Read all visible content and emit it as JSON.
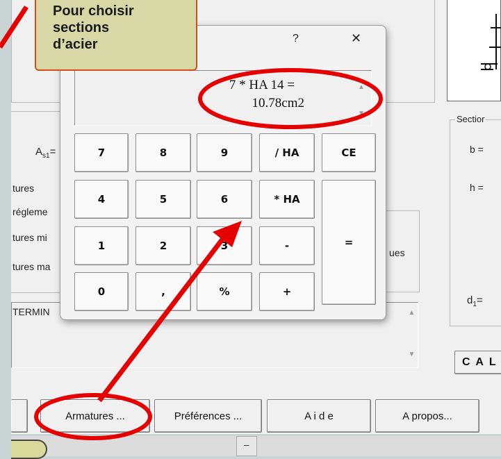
{
  "callout": {
    "lines": [
      "Pour  choisir",
      "sections",
      "d’acier"
    ]
  },
  "background": {
    "as1_label": "A",
    "as1_sub": "s1",
    "as1_eq": "=",
    "left_labels": [
      "tures",
      "régleme",
      "tures mi",
      "tures ma"
    ],
    "ues_label": "ues",
    "terminal_text": "TERMIN",
    "section_group_label": "Sectior",
    "right_labels": [
      "b =",
      "h ="
    ],
    "d1_label": "d",
    "d1_sub": "1",
    "d1_eq": "=",
    "cal_button": "C A L",
    "minus_mark": "–"
  },
  "toolbar": {
    "armatures": "Armatures ...",
    "preferences": "Préférences ...",
    "aide": "A i d e",
    "apropos": "A propos..."
  },
  "calculator": {
    "help_glyph": "?",
    "close_glyph": "✕",
    "display_line1": "7 * HA 14 =",
    "display_line2": "10.78cm2",
    "scroll_up": "▲",
    "scroll_down": "▼",
    "keys": {
      "k7": "7",
      "k8": "8",
      "k9": "9",
      "div_ha": "/ HA",
      "ce": "CE",
      "k4": "4",
      "k5": "5",
      "k6": "6",
      "mul_ha": "* HA",
      "k1": "1",
      "k2": "2",
      "k3": "3",
      "minus": "-",
      "equals": "=",
      "k0": "0",
      "dot": ",",
      "percent": "%",
      "plus": "+"
    }
  },
  "colors": {
    "highlight_red": "#e50000",
    "callout_fill": "#d7d8a6"
  }
}
